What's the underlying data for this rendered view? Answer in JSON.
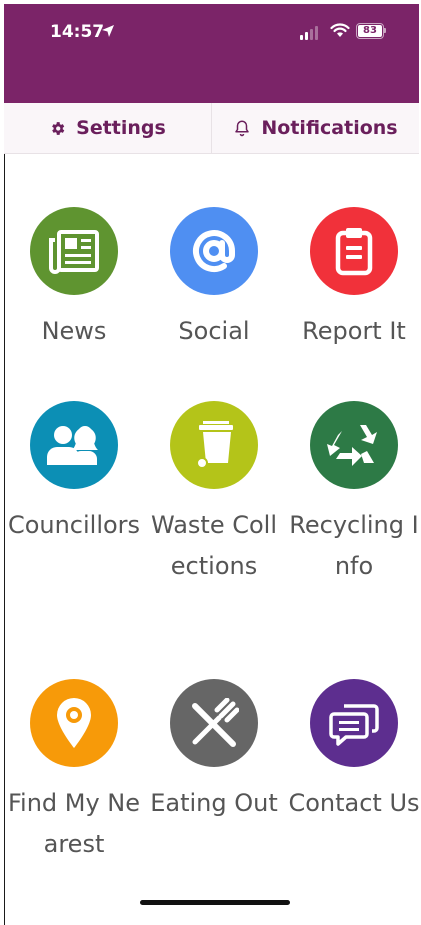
{
  "status_bar": {
    "time": "14:57",
    "battery": "83"
  },
  "tabs": {
    "settings": "Settings",
    "notifications": "Notifications"
  },
  "colors": {
    "header": "#7b2468",
    "tab_text": "#6a1f5c",
    "label": "#555555"
  },
  "tiles": [
    {
      "label": "News",
      "color": "#5f9430",
      "icon": "newspaper-icon"
    },
    {
      "label": "Social",
      "color": "#4f8ff2",
      "icon": "at-sign-icon"
    },
    {
      "label": "Report It",
      "color": "#f1313a",
      "icon": "clipboard-icon"
    },
    {
      "label": "Councillors",
      "color": "#0c8fb5",
      "icon": "people-icon"
    },
    {
      "label": "Waste Collections",
      "color": "#b4c419",
      "icon": "wheelie-bin-icon"
    },
    {
      "label": "Recycling Info",
      "color": "#2d7a46",
      "icon": "recycle-icon"
    },
    {
      "label": "Find My Nearest",
      "color": "#f79a09",
      "icon": "map-pin-icon"
    },
    {
      "label": "Eating Out",
      "color": "#666666",
      "icon": "cutlery-icon"
    },
    {
      "label": "Contact Us",
      "color": "#5d2e8f",
      "icon": "chat-bubbles-icon"
    }
  ]
}
